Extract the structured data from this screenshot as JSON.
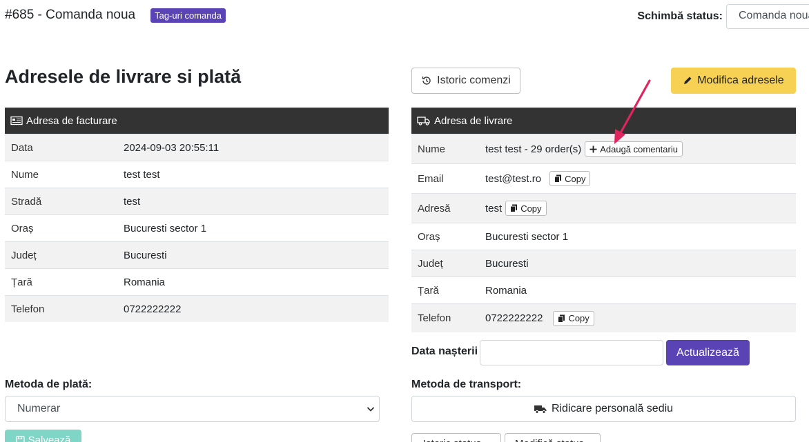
{
  "header": {
    "order_title": "#685 - Comanda noua",
    "tag_label": "Tag-uri comanda",
    "status_label": "Schimbă status:",
    "status_value": "Comanda noua"
  },
  "section_title": "Adresele de livrare si plată",
  "buttons": {
    "history": "Istoric comenzi",
    "modify": "Modifica adresele",
    "update": "Actualizează",
    "save": "Salvează",
    "copy": "Copy",
    "add_comment": "Adaugă comentariu",
    "bottom_left": "Istoric status",
    "bottom_right": "Modifică status"
  },
  "billing": {
    "title": "Adresa de facturare",
    "rows": [
      {
        "label": "Data",
        "value": "2024-09-03 20:55:11"
      },
      {
        "label": "Nume",
        "value": "test test"
      },
      {
        "label": "Stradă",
        "value": "test"
      },
      {
        "label": "Oraș",
        "value": "Bucuresti sector 1"
      },
      {
        "label": "Județ",
        "value": "Bucuresti"
      },
      {
        "label": "Țară",
        "value": "Romania"
      },
      {
        "label": "Telefon",
        "value": "0722222222"
      }
    ]
  },
  "shipping": {
    "title": "Adresa de livrare",
    "rows": [
      {
        "label": "Nume",
        "value": "test test - 29 order(s)"
      },
      {
        "label": "Email",
        "value": "test@test.ro"
      },
      {
        "label": "Adresă",
        "value": "test"
      },
      {
        "label": "Oraș",
        "value": "Bucuresti sector 1"
      },
      {
        "label": "Județ",
        "value": "Bucuresti"
      },
      {
        "label": "Țară",
        "value": "Romania"
      },
      {
        "label": "Telefon",
        "value": "0722222222"
      }
    ]
  },
  "birthdate": {
    "label": "Data nașterii",
    "value": ""
  },
  "payment": {
    "label": "Metoda de plată:",
    "selected": "Numerar"
  },
  "transport": {
    "label": "Metoda de transport:",
    "selected": "Ridicare personală sediu"
  },
  "colors": {
    "accent": "#5a43b5",
    "warning": "#f7d154",
    "dark_header": "#333333",
    "success_light": "#7fd6c7",
    "annotation_arrow": "#e0245e"
  }
}
